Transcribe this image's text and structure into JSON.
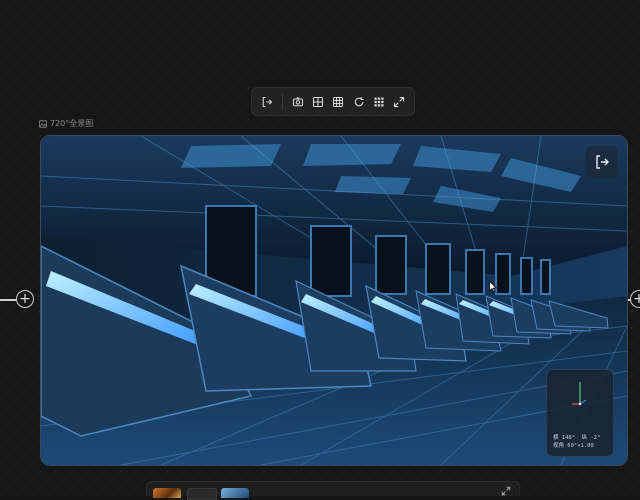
{
  "node": {
    "label": "720°全景图",
    "label_icon": "image-icon"
  },
  "toolbar": {
    "items": [
      {
        "name": "exit-button",
        "icon": "exit-icon"
      },
      {
        "name": "screenshot-button",
        "icon": "camera-icon"
      },
      {
        "name": "grid-button",
        "icon": "grid-icon"
      },
      {
        "name": "grid-dense-button",
        "icon": "grid-dense-icon"
      },
      {
        "name": "rotate-button",
        "icon": "rotate-icon"
      },
      {
        "name": "dots-grid-button",
        "icon": "dots-grid-icon"
      },
      {
        "name": "fullscreen-button",
        "icon": "expand-icon"
      }
    ]
  },
  "gizmo": {
    "line1": "横 148°  纵 -2°",
    "line2": "视角 60°×1.00"
  },
  "colors": {
    "background": "#161616",
    "accent_blue": "#2e8fff",
    "glow": "#6fd0ff"
  }
}
